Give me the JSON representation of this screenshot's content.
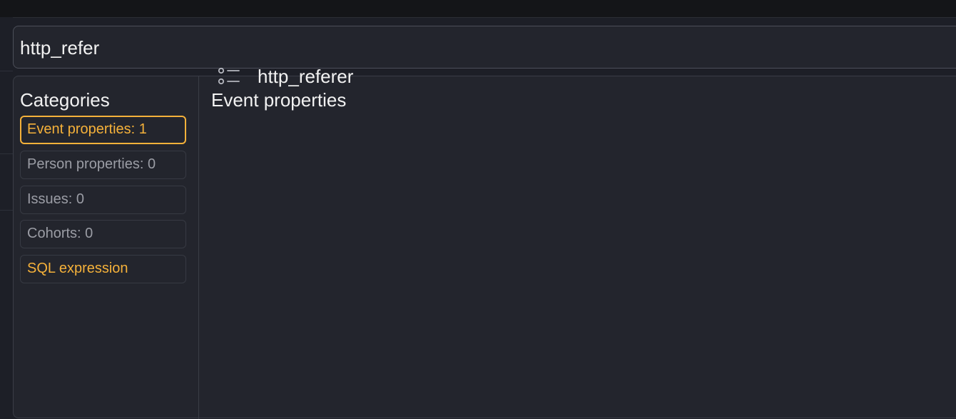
{
  "search": {
    "value": "http_refer"
  },
  "categories": {
    "title": "Categories",
    "items": [
      {
        "label": "Event properties: 1",
        "state": "active"
      },
      {
        "label": "Person properties: 0",
        "state": "inactive"
      },
      {
        "label": "Issues: 0",
        "state": "inactive"
      },
      {
        "label": "Cohorts: 0",
        "state": "inactive"
      },
      {
        "label": "SQL expression",
        "state": "highlight"
      }
    ]
  },
  "results": {
    "title": "Event properties",
    "items": [
      {
        "label": "http_referer",
        "icon": "property-list-icon"
      }
    ]
  },
  "colors": {
    "accent": "#f5b13a",
    "background": "#23252d",
    "text": "#f2f2f2",
    "muted_text": "#9b9da5"
  }
}
